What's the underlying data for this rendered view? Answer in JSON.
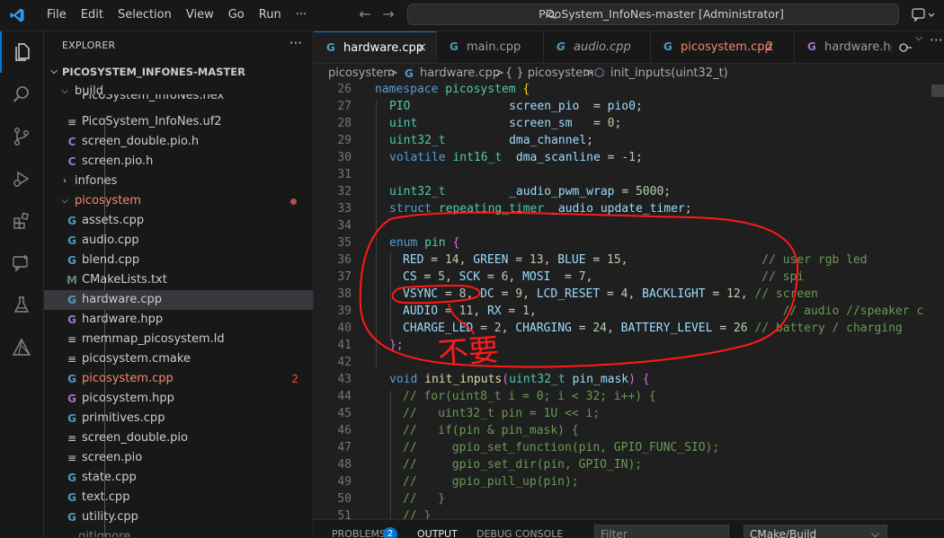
{
  "menu": [
    "File",
    "Edit",
    "Selection",
    "View",
    "Go",
    "Run",
    "···"
  ],
  "command_center": "PicoSystem_InfoNes-master [Administrator]",
  "explorer": {
    "title": "EXPLORER",
    "more": "···",
    "root": "PICOSYSTEM_INFONES-MASTER",
    "items": [
      {
        "label": "build",
        "icon": "",
        "badge": ""
      },
      {
        "label": "PicoSystem_InfoNes.hex",
        "icon": "",
        "badge": ""
      },
      {
        "label": "PicoSystem_InfoNes.uf2",
        "icon": "",
        "badge": ""
      },
      {
        "label": "screen_double.pio.h",
        "icon": "C",
        "badge": ""
      },
      {
        "label": "screen.pio.h",
        "icon": "C",
        "badge": ""
      },
      {
        "label": "infones",
        "icon": "",
        "badge": ""
      },
      {
        "label": "picosystem",
        "icon": "",
        "badge": ""
      },
      {
        "label": "assets.cpp",
        "icon": "G",
        "badge": ""
      },
      {
        "label": "audio.cpp",
        "icon": "G",
        "badge": ""
      },
      {
        "label": "blend.cpp",
        "icon": "G",
        "badge": ""
      },
      {
        "label": "CMakeLists.txt",
        "icon": "M",
        "badge": ""
      },
      {
        "label": "hardware.cpp",
        "icon": "G",
        "badge": ""
      },
      {
        "label": "hardware.hpp",
        "icon": "G",
        "badge": ""
      },
      {
        "label": "memmap_picosystem.ld",
        "icon": "",
        "badge": ""
      },
      {
        "label": "picosystem.cmake",
        "icon": "",
        "badge": ""
      },
      {
        "label": "picosystem.cpp",
        "icon": "G",
        "badge": "2"
      },
      {
        "label": "picosystem.hpp",
        "icon": "G",
        "badge": ""
      },
      {
        "label": "primitives.cpp",
        "icon": "G",
        "badge": ""
      },
      {
        "label": "screen_double.pio",
        "icon": "",
        "badge": ""
      },
      {
        "label": "screen.pio",
        "icon": "",
        "badge": ""
      },
      {
        "label": "state.cpp",
        "icon": "G",
        "badge": ""
      },
      {
        "label": "text.cpp",
        "icon": "G",
        "badge": ""
      },
      {
        "label": "utility.cpp",
        "icon": "G",
        "badge": ""
      },
      {
        "label": ".gitignore",
        "icon": "",
        "badge": ""
      }
    ]
  },
  "tabs": [
    {
      "label": "hardware.cpp",
      "icon": "G",
      "close": "×"
    },
    {
      "label": "main.cpp",
      "icon": "G"
    },
    {
      "label": "audio.cpp",
      "icon": "G"
    },
    {
      "label": "picosystem.cpp",
      "icon": "G",
      "badge": "2"
    },
    {
      "label": "hardware.hp",
      "icon": "G"
    }
  ],
  "breadcrumb": [
    "picosystem",
    ">",
    "hardware.cpp",
    ">",
    "{ } picosystem",
    ">",
    "init_inputs(uint32_t)"
  ],
  "code": {
    "l26": [
      "26",
      "namespace",
      "picosystem",
      "{"
    ],
    "l27": [
      "27",
      "PIO",
      "screen_pio",
      "=",
      "pio0",
      ";"
    ],
    "l28": [
      "28",
      "uint",
      "screen_sm",
      "=",
      "0",
      ";"
    ],
    "l29": [
      "29",
      "uint32_t",
      "dma_channel",
      ";"
    ],
    "l30": [
      "30",
      "volatile",
      "int16_t",
      "dma_scanline",
      "=",
      "-1",
      ";"
    ],
    "l31": [
      "31"
    ],
    "l32": [
      "32",
      "uint32_t",
      "_audio_pwm_wrap",
      "=",
      "5000",
      ";"
    ],
    "l33": [
      "33",
      "struct",
      "repeating_timer",
      "_audio_update_timer",
      ";"
    ],
    "l34": [
      "34"
    ],
    "l35": [
      "35",
      "enum",
      "pin",
      "{"
    ],
    "l36": [
      "36",
      "RED",
      "14",
      "GREEN",
      "13",
      "BLUE",
      "15",
      "// user rgb led"
    ],
    "l37": [
      "37",
      "CS",
      "5",
      "SCK",
      "6",
      "MOSI",
      "7",
      "// spi"
    ],
    "l38": [
      "38",
      "VSYNC",
      "8",
      "DC",
      "9",
      "LCD_RESET",
      "4",
      "BACKLIGHT",
      "12",
      "// screen"
    ],
    "l39": [
      "39",
      "AUDIO",
      "11",
      "RX",
      "1",
      "// audio //speaker c"
    ],
    "l40": [
      "40",
      "CHARGE_LED",
      "2",
      "CHARGING",
      "24",
      "BATTERY_LEVEL",
      "26",
      "// battery / charging"
    ],
    "l41": [
      "41",
      "};"
    ],
    "l42": [
      "42"
    ],
    "l43": [
      "43",
      "void",
      "init_inputs",
      "uint32_t",
      "pin_mask",
      "{"
    ],
    "l44": [
      "44",
      "// for(uint8_t i = 0; i < 32; i++) {"
    ],
    "l45": [
      "45",
      "//   uint32_t pin = 1U << i;"
    ],
    "l46": [
      "46",
      "//   if(pin & pin_mask) {"
    ],
    "l47": [
      "47",
      "//     gpio_set_function(pin, GPIO_FUNC_SIO);"
    ],
    "l48": [
      "48",
      "//     gpio_set_dir(pin, GPIO_IN);"
    ],
    "l49": [
      "49",
      "//     gpio_pull_up(pin);"
    ],
    "l50": [
      "50",
      "//   }"
    ],
    "l51": [
      "51",
      "// }"
    ]
  },
  "annotation": {
    "handwritten_text": "不要",
    "color": "#ff1a1a"
  },
  "panel": {
    "tabs": [
      "PROBLEMS",
      "OUTPUT",
      "DEBUG CONSOLE"
    ],
    "problems_count": "2",
    "filter_placeholder": "Filter",
    "output_source": "CMake/Build"
  },
  "colors": {
    "accent": "#0078d4",
    "error": "#f14c4c",
    "keyword": "#569cd6",
    "type": "#4ec9b0",
    "variable": "#9cdcfe",
    "number": "#b5cea8",
    "comment": "#6a9955"
  }
}
